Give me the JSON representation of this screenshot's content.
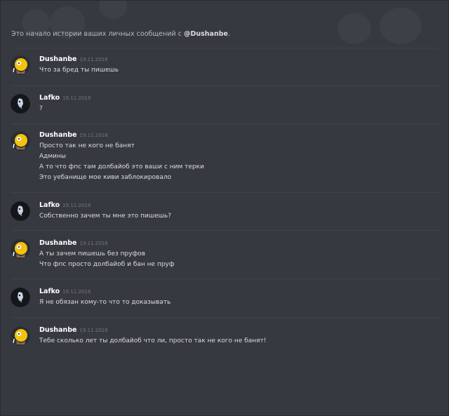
{
  "chat": {
    "intro_prefix": "Это начало истории ваших личных сообщений с ",
    "intro_user": "@Dushanbe",
    "intro_suffix": "."
  },
  "users": {
    "dushanbe": {
      "name": "Dushanbe",
      "avatar_icon": "homer-avatar-icon",
      "accent": "#f4c20d"
    },
    "lafko": {
      "name": "Lafko",
      "avatar_icon": "skull-avatar-icon",
      "accent": "#1a1d22"
    }
  },
  "messages": [
    {
      "user": "Dushanbe",
      "time": "19.11.2018",
      "lines": [
        "Что за бред ты пишешь"
      ]
    },
    {
      "user": "Lafko",
      "time": "19.11.2018",
      "lines": [
        "?"
      ]
    },
    {
      "user": "Dushanbe",
      "time": "19.11.2018",
      "lines": [
        "Просто так не кого не банят",
        "Админы",
        "А то что фпс там долбайоб это ваши с ним терки",
        "Это уебанище мое киви заблокировало"
      ]
    },
    {
      "user": "Lafko",
      "time": "19.11.2018",
      "lines": [
        "Собственно зачем ты мне это пишешь?"
      ]
    },
    {
      "user": "Dushanbe",
      "time": "19.11.2018",
      "lines": [
        "А ты зачем пишешь без пруфов",
        "Что фпс просто долбайоб и бан не пруф"
      ]
    },
    {
      "user": "Lafko",
      "time": "19.11.2018",
      "lines": [
        "Я не обязан кому-то что то доказывать"
      ]
    },
    {
      "user": "Dushanbe",
      "time": "19.11.2018",
      "lines": [
        "Тебе сколько лет ты долбайоб что ли, просто так не кого не банят!"
      ]
    }
  ]
}
